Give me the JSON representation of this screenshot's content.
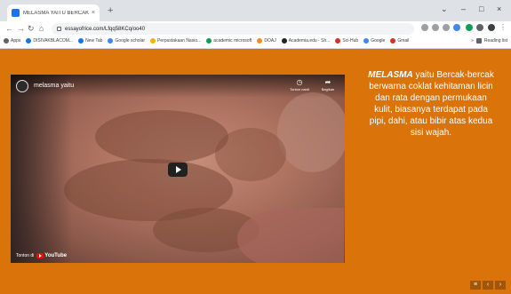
{
  "browser": {
    "tab_title": "MELASMA YAITU BERCAK-BE",
    "tab_close": "×",
    "new_tab": "+",
    "window_controls": {
      "chevron": "⌄",
      "minimize": "–",
      "maximize": "□",
      "close": "×"
    },
    "url": "essayofrice.com/Lfqq58KCq/oo40",
    "bookmarks": [
      {
        "label": "Apps",
        "color": "#5f6368"
      },
      {
        "label": "DISIVAKBLACOM...",
        "color": "#1a73e8"
      },
      {
        "label": "New Tab",
        "color": "#1a73e8"
      },
      {
        "label": "Google scholar",
        "color": "#4285f4"
      },
      {
        "label": "Perpustakaan Nasio...",
        "color": "#f4b400"
      },
      {
        "label": "academic microsoft",
        "color": "#0f9d58"
      },
      {
        "label": "DOAJ",
        "color": "#f28b25"
      },
      {
        "label": "Academia.edu - Sh...",
        "color": "#222222"
      },
      {
        "label": "Sci-Hub",
        "color": "#d93025"
      },
      {
        "label": "Google",
        "color": "#4285f4"
      },
      {
        "label": "Gmail",
        "color": "#d93025"
      }
    ],
    "bookmarks_overflow": "»",
    "reading_list": "Reading list"
  },
  "video": {
    "title": "melasma yaitu",
    "watch_later_icon": "clock-icon",
    "watch_later_label": "Tonton nanti",
    "share_icon": "share-icon",
    "share_label": "Bagikan",
    "watch_on_label": "Tonton di",
    "youtube_label": "YouTube"
  },
  "description": {
    "keyword": "MELASMA",
    "text": " yaitu Bercak-bercak berwarna coklat kehitaman licin dan rata dengan permukaan kulit, biasanya terdapat pada pipi, dahi, atau bibir atas kedua sisi wajah."
  },
  "nav": {
    "menu": "≡",
    "prev": "‹",
    "next": "›"
  },
  "colors": {
    "page_bg": "#d9730a",
    "text": "#ffffff"
  }
}
